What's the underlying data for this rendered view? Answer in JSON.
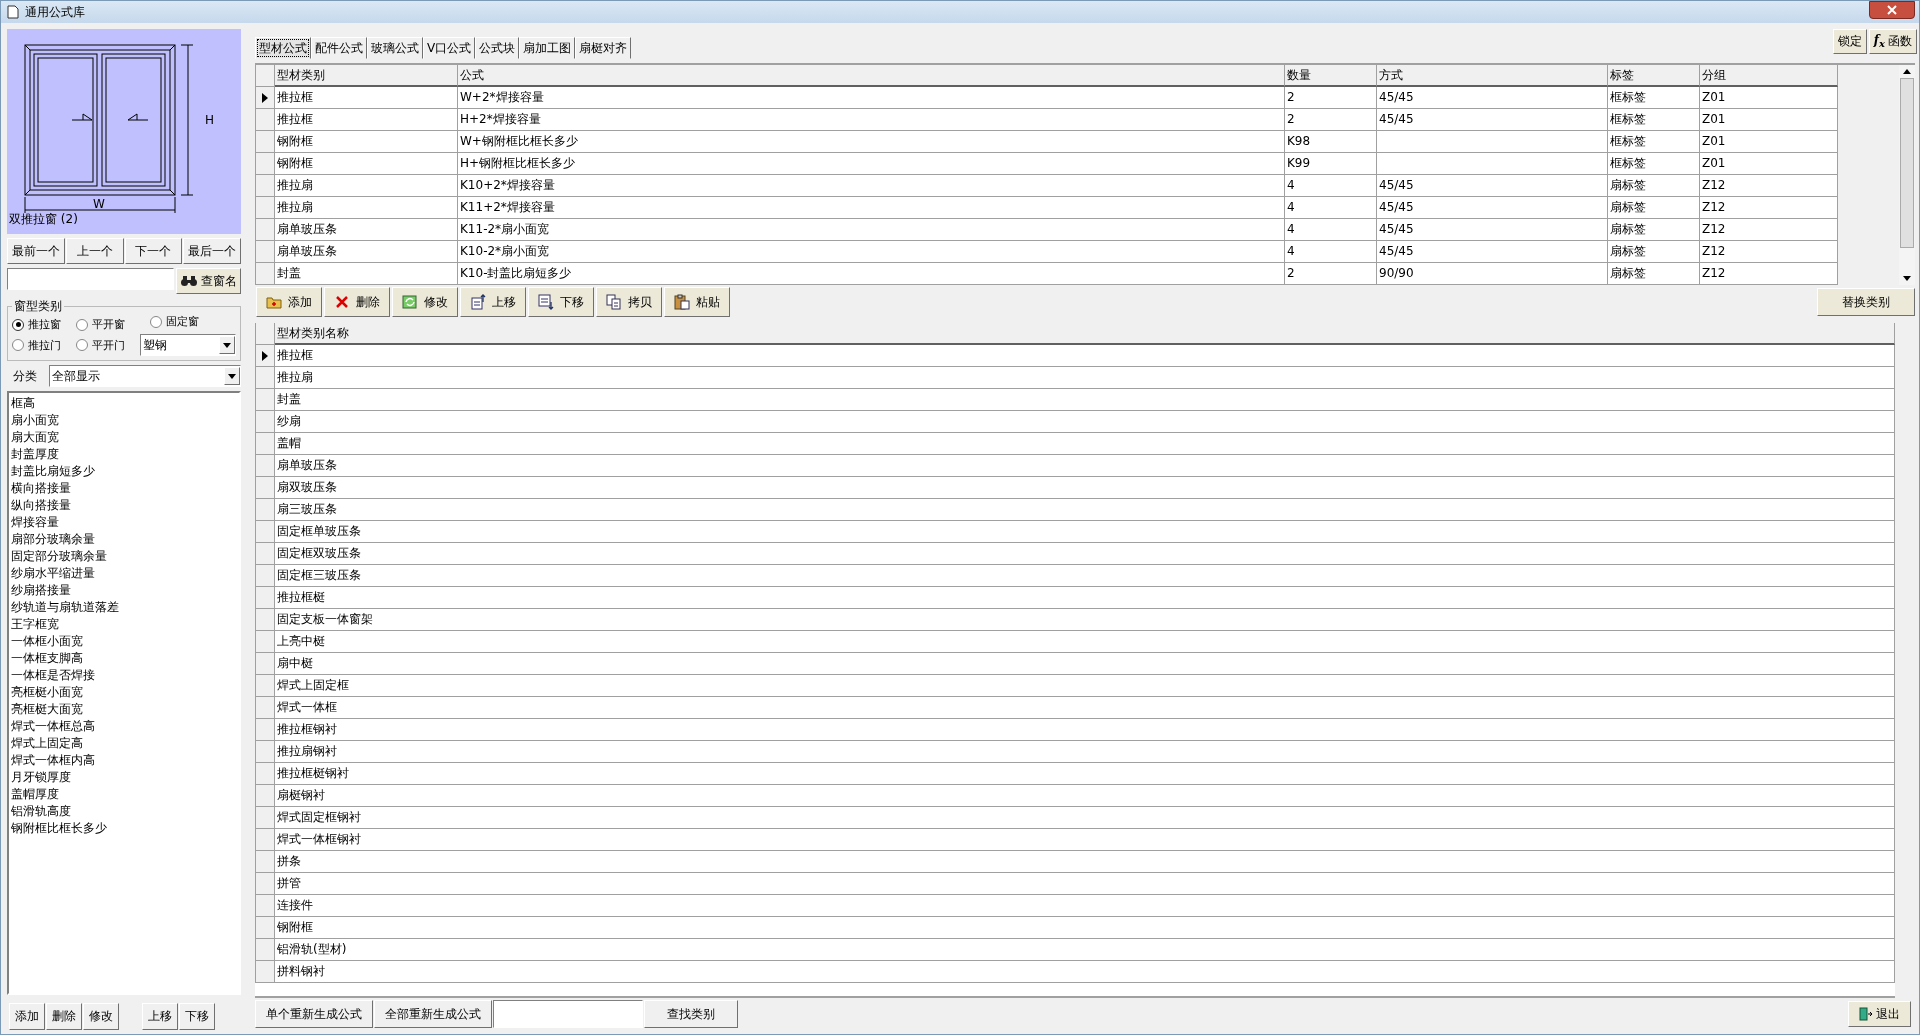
{
  "window": {
    "title": "通用公式库"
  },
  "preview": {
    "caption": "双推拉窗 (2)",
    "width_label": "W",
    "height_label": "H"
  },
  "nav_buttons": [
    "最前一个",
    "上一个",
    "下一个",
    "最后一个"
  ],
  "search": {
    "button": "查窗名"
  },
  "window_type": {
    "legend": "窗型类别",
    "options": [
      {
        "label": "推拉窗",
        "selected": true
      },
      {
        "label": "平开窗",
        "selected": false
      },
      {
        "label": "固定窗",
        "selected": false
      },
      {
        "label": "推拉门",
        "selected": false
      },
      {
        "label": "平开门",
        "selected": false
      }
    ],
    "material": "塑钢"
  },
  "category": {
    "label": "分类",
    "value": "全部显示"
  },
  "params": [
    "框高",
    "扇小面宽",
    "扇大面宽",
    "封盖厚度",
    "封盖比扇短多少",
    "横向搭接量",
    "纵向搭接量",
    "焊接容量",
    "扇部分玻璃余量",
    "固定部分玻璃余量",
    "纱扇水平缩进量",
    "纱扇搭接量",
    "纱轨道与扇轨道落差",
    "王字框宽",
    "一体框小面宽",
    "一体框支脚高",
    "一体框是否焊接",
    "亮框梃小面宽",
    "亮框梃大面宽",
    "焊式一体框总高",
    "焊式上固定高",
    "焊式一体框内高",
    "月牙锁厚度",
    "盖帽厚度",
    "铝滑轨高度",
    "钢附框比框长多少"
  ],
  "left_buttons": [
    "添加",
    "删除",
    "修改",
    "上移",
    "下移"
  ],
  "tabs": [
    {
      "label": "型材公式",
      "selected": true
    },
    {
      "label": "配件公式",
      "selected": false
    },
    {
      "label": "玻璃公式",
      "selected": false
    },
    {
      "label": "V口公式",
      "selected": false
    },
    {
      "label": "公式块",
      "selected": false
    },
    {
      "label": "扇加工图",
      "selected": false
    },
    {
      "label": "扇梃对齐",
      "selected": false
    }
  ],
  "top_buttons": [
    {
      "label": "锁定",
      "kind": "plain"
    },
    {
      "label": "函数",
      "kind": "function",
      "icon": "f$_{x}$"
    }
  ],
  "formula_table": {
    "columns": [
      "型材类别",
      "公式",
      "数量",
      "方式",
      "标签",
      "分组"
    ],
    "rows": [
      {
        "selected": true,
        "cells": [
          "推拉框",
          "W+2*焊接容量",
          "2",
          "45/45",
          "框标签",
          "Z01"
        ]
      },
      {
        "selected": false,
        "cells": [
          "推拉框",
          "H+2*焊接容量",
          "2",
          "45/45",
          "框标签",
          "Z01"
        ]
      },
      {
        "selected": false,
        "cells": [
          "钢附框",
          "W+钢附框比框长多少",
          "K98",
          "",
          "框标签",
          "Z01"
        ]
      },
      {
        "selected": false,
        "cells": [
          "钢附框",
          "H+钢附框比框长多少",
          "K99",
          "",
          "框标签",
          "Z01"
        ]
      },
      {
        "selected": false,
        "cells": [
          "推拉扇",
          "K10+2*焊接容量",
          "4",
          "45/45",
          "扇标签",
          "Z12"
        ]
      },
      {
        "selected": false,
        "cells": [
          "推拉扇",
          "K11+2*焊接容量",
          "4",
          "45/45",
          "扇标签",
          "Z12"
        ]
      },
      {
        "selected": false,
        "cells": [
          "扇单玻压条",
          "K11-2*扇小面宽",
          "4",
          "45/45",
          "扇标签",
          "Z12"
        ]
      },
      {
        "selected": false,
        "cells": [
          "扇单玻压条",
          "K10-2*扇小面宽",
          "4",
          "45/45",
          "扇标签",
          "Z12"
        ]
      },
      {
        "selected": false,
        "cells": [
          "封盖",
          "K10-封盖比扇短多少",
          "2",
          "90/90",
          "扇标签",
          "Z12"
        ]
      }
    ]
  },
  "toolbar": [
    {
      "label": "添加",
      "kind": "add"
    },
    {
      "label": "删除",
      "kind": "delete"
    },
    {
      "label": "修改",
      "kind": "edit"
    },
    {
      "label": "上移",
      "kind": "up"
    },
    {
      "label": "下移",
      "kind": "down"
    },
    {
      "label": "拷贝",
      "kind": "copy"
    },
    {
      "label": "粘贴",
      "kind": "paste"
    }
  ],
  "replace_button": "替换类别",
  "category_table": {
    "column": "型材类别名称",
    "rows": [
      {
        "name": "推拉框",
        "selected": true
      },
      {
        "name": "推拉扇",
        "selected": false
      },
      {
        "name": "封盖",
        "selected": false
      },
      {
        "name": "纱扇",
        "selected": false
      },
      {
        "name": "盖帽",
        "selected": false
      },
      {
        "name": "扇单玻压条",
        "selected": false
      },
      {
        "name": "扇双玻压条",
        "selected": false
      },
      {
        "name": "扇三玻压条",
        "selected": false
      },
      {
        "name": "固定框单玻压条",
        "selected": false
      },
      {
        "name": "固定框双玻压条",
        "selected": false
      },
      {
        "name": "固定框三玻压条",
        "selected": false
      },
      {
        "name": "推拉框梃",
        "selected": false
      },
      {
        "name": "固定支板一体窗架",
        "selected": false
      },
      {
        "name": "上亮中梃",
        "selected": false
      },
      {
        "name": "扇中梃",
        "selected": false
      },
      {
        "name": "焊式上固定框",
        "selected": false
      },
      {
        "name": "焊式一体框",
        "selected": false
      },
      {
        "name": "推拉框钢衬",
        "selected": false
      },
      {
        "name": "推拉扇钢衬",
        "selected": false
      },
      {
        "name": "推拉框梃钢衬",
        "selected": false
      },
      {
        "name": "扇梃钢衬",
        "selected": false
      },
      {
        "name": "焊式固定框钢衬",
        "selected": false
      },
      {
        "name": "焊式一体框钢衬",
        "selected": false
      },
      {
        "name": "拼条",
        "selected": false
      },
      {
        "name": "拼管",
        "selected": false
      },
      {
        "name": "连接件",
        "selected": false
      },
      {
        "name": "钢附框",
        "selected": false
      },
      {
        "name": "铝滑轨(型材)",
        "selected": false
      },
      {
        "name": "拼料钢衬",
        "selected": false
      }
    ]
  },
  "bottom": {
    "buttons": [
      "单个重新生成公式",
      "全部重新生成公式"
    ],
    "find_button": "查找类别",
    "exit_button": "退出"
  }
}
